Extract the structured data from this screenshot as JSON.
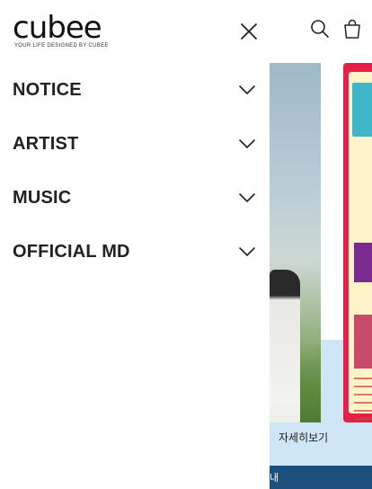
{
  "brand": {
    "logo_text": "cubee",
    "tagline": "YOUR LIFE DESIGNED BY CUBEE"
  },
  "drawer": {
    "close_label": "close",
    "menu": [
      {
        "label": "NOTICE"
      },
      {
        "label": "ARTIST"
      },
      {
        "label": "MUSIC"
      },
      {
        "label": "OFFICIAL MD"
      }
    ]
  },
  "background": {
    "more_link": "자세히보기",
    "bottom_bar_text": "내"
  },
  "icons": {
    "search": "search-icon",
    "cart": "shopping-bag-icon",
    "close": "close-icon",
    "chevron": "chevron-down-icon"
  },
  "colors": {
    "accent_blue": "#1a4f7e",
    "band": "#cfe6f6",
    "poster_red": "#e2204a"
  }
}
